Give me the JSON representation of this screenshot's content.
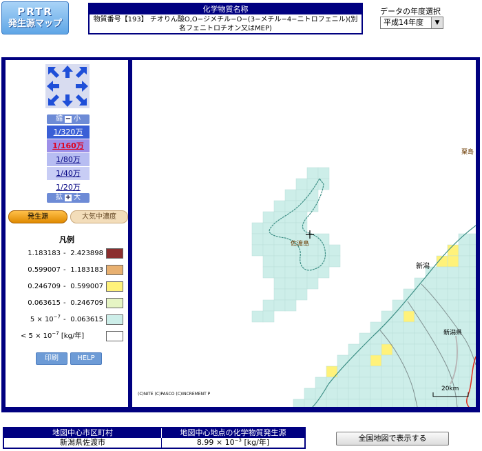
{
  "logo": {
    "line1": "PRTR",
    "line2": "発生源マップ"
  },
  "chemical": {
    "header": "化学物質名称",
    "name": "物質番号【193】 チオりん酸O,O−ジメチル−O−(3−メチル−4−ニトロフェニル)(別名フェニトロチオン又はMEP)"
  },
  "year": {
    "label": "データの年度選択",
    "selected": "平成14年度"
  },
  "zoom": {
    "shrink_label": "縮",
    "shrink_suffix": "小",
    "expand_label": "拡",
    "expand_suffix": "大",
    "scales": [
      {
        "label": "1/320万",
        "bg": "#3a5fd6",
        "color": "#ffffff"
      },
      {
        "label": "1/160万",
        "bg": "#9d90e8",
        "color": "#e0001b"
      },
      {
        "label": "1/80万",
        "bg": "#b7bdf2",
        "color": "#000080"
      },
      {
        "label": "1/40万",
        "bg": "#c8cdf5",
        "color": "#000080"
      },
      {
        "label": "1/20万",
        "bg": "#ffffff",
        "color": "#000080"
      }
    ]
  },
  "tabs": {
    "source": "発生源",
    "air": "大気中濃度"
  },
  "legend": {
    "title": "凡例",
    "rows": [
      {
        "lo": "1.183183",
        "hi": "2.423898",
        "color": "#8b2e2e"
      },
      {
        "lo": "0.599007",
        "hi": "1.183183",
        "color": "#e8b070"
      },
      {
        "lo": "0.246709",
        "hi": "0.599007",
        "color": "#fff27a"
      },
      {
        "lo": "0.063615",
        "hi": "0.246709",
        "color": "#e6f5c4"
      },
      {
        "lo_base": "5 × 10",
        "lo_exp": "−7",
        "hi": "0.063615",
        "color": "#cdeee9"
      }
    ],
    "last": {
      "text_pre": "< 5 × 10",
      "exp": "−7",
      "unit": "[kg/年]",
      "color": "#ffffff"
    }
  },
  "buttons": {
    "print": "印刷",
    "help": "HELP",
    "national": "全国地図で表示する"
  },
  "map": {
    "labels": {
      "sado": "佐渡島",
      "niigata": "新潟",
      "niigata_pref": "新潟県",
      "awashima": "粟島"
    },
    "copyright": "(C)NITE (C)PASCO (C)INCREMENT P",
    "scalebar": "20km"
  },
  "bottom": {
    "h_city": "地図中心市区町村",
    "city": "新潟県佐渡市",
    "h_source": "地図中心地点の化学物質発生源",
    "value_pre": "8.99 × 10",
    "value_exp": "−3",
    "value_unit": "[kg/年]"
  },
  "colors": {
    "frame": "#000080",
    "sea_cell": "#cdeee9",
    "yellow_cell": "#fff27a"
  }
}
